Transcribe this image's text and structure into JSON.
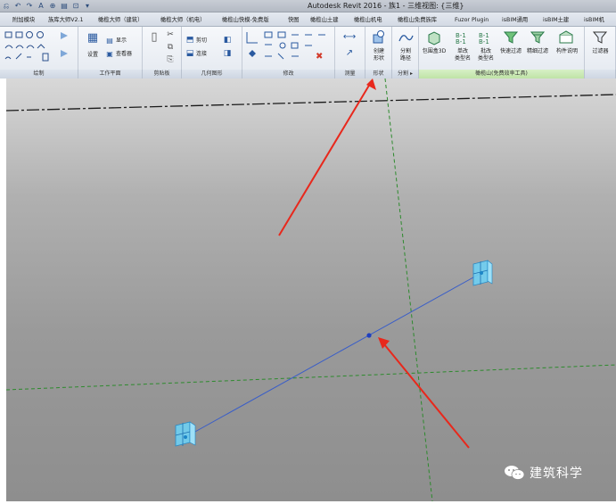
{
  "window": {
    "title": "Autodesk Revit 2016 -    族1 - 三维视图: {三维}"
  },
  "quick_access": [
    "⎌",
    "↶",
    "↷",
    "A",
    "⊕",
    "▤",
    "⊡",
    "▾"
  ],
  "tabs": [
    "附加模块",
    "族库大师V2.1",
    "橄榄大师（建筑）",
    "橄榄大师（机电）",
    "橄榄山快模-免费版",
    "快图",
    "橄榄山土建",
    "橄榄山机电",
    "橄榄山免费族库",
    "Fuzor Plugin",
    "isBIM通用",
    "isBIM土建",
    "isBIM机"
  ],
  "ribbon": {
    "panels": {
      "draw": "绘制",
      "work_plane": "工作平面",
      "clipboard": "剪贴板",
      "geometry": "几何图形",
      "modify": "修改",
      "measure": "测量",
      "shape": "形状",
      "divide": "分割 ▸",
      "olive_tools": "橄榄山(免费效率工具)"
    },
    "buttons": {
      "set": "设置",
      "show": "显示",
      "viewer": "查看器",
      "cut": "剪切",
      "join": "连接",
      "create_form_1": "创建",
      "create_form_2": "形状",
      "divide_path_1": "分割",
      "divide_path_2": "路径",
      "box3d": "包围盒3D",
      "single_change_1": "单改",
      "single_change_2": "类型名",
      "batch_change_1": "批改",
      "batch_change_2": "类型名",
      "quick_filter": "快速过滤",
      "fine_filter": "精细过滤",
      "component_info": "构件说明",
      "filter": "过滤器"
    }
  },
  "watermark": "建筑科学",
  "colors": {
    "accent": "#2a5aa0",
    "arrow": "#e8281c",
    "ref_line": "#2d8a2d",
    "model_line": "#3a5ec8",
    "element": "#29a8e0"
  }
}
